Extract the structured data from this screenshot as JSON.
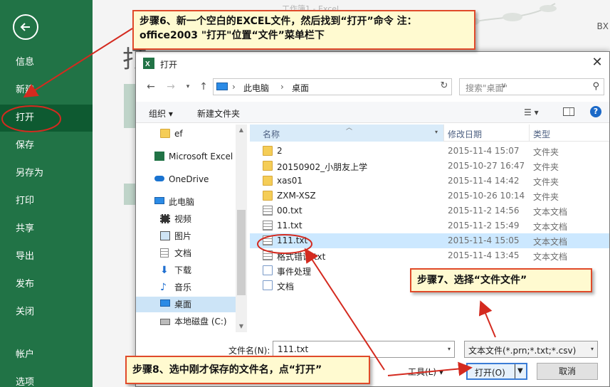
{
  "excel": {
    "doc_title": "工作簿1 - Excel",
    "user": "BX",
    "heading": "打",
    "nav_items": [
      "信息",
      "新建",
      "打开",
      "保存",
      "另存为",
      "打印",
      "共享",
      "导出",
      "发布",
      "关闭",
      "帐户",
      "选项"
    ],
    "active_item": "打开"
  },
  "dialog": {
    "title": "打开",
    "close_glyph": "✕",
    "address": {
      "pc": "此电脑",
      "folder": "桌面"
    },
    "search_placeholder": "搜索\"桌面\"",
    "toolbar": {
      "organize": "组织 ▾",
      "new_folder": "新建文件夹",
      "view_glyph": "☰ ▾",
      "help": "?"
    },
    "nav_tree": [
      {
        "label": "ef",
        "icon": "folder-icon"
      },
      {
        "label": "Microsoft Excel",
        "icon": "excel-icon"
      },
      {
        "label": "OneDrive",
        "icon": "cloud-icon"
      },
      {
        "label": "此电脑",
        "icon": "computer-icon"
      },
      {
        "label": "视频",
        "icon": "video-icon"
      },
      {
        "label": "图片",
        "icon": "picture-icon"
      },
      {
        "label": "文档",
        "icon": "document-icon"
      },
      {
        "label": "下载",
        "icon": "download-icon"
      },
      {
        "label": "音乐",
        "icon": "music-icon"
      },
      {
        "label": "桌面",
        "icon": "desktop-icon"
      },
      {
        "label": "本地磁盘 (C:)",
        "icon": "drive-icon"
      }
    ],
    "columns": {
      "name": "名称",
      "modified": "修改日期",
      "type": "类型"
    },
    "files": [
      {
        "name": "2",
        "date": "2015-11-4 15:07",
        "type": "文件夹",
        "kind": "folder"
      },
      {
        "name": "20150902_小朋友上学",
        "date": "2015-10-27 16:47",
        "type": "文件夹",
        "kind": "folder"
      },
      {
        "name": "xas01",
        "date": "2015-11-4 14:42",
        "type": "文件夹",
        "kind": "folder"
      },
      {
        "name": "ZXM-XSZ",
        "date": "2015-10-26 10:14",
        "type": "文件夹",
        "kind": "folder"
      },
      {
        "name": "00.txt",
        "date": "2015-11-2 14:56",
        "type": "文本文档",
        "kind": "txt"
      },
      {
        "name": "11.txt",
        "date": "2015-11-2 15:49",
        "type": "文本文档",
        "kind": "txt"
      },
      {
        "name": "111.txt",
        "date": "2015-11-4 15:05",
        "type": "文本文档",
        "kind": "txt"
      },
      {
        "name": "格式错误.txt",
        "date": "2015-11-4 13:45",
        "type": "文本文档",
        "kind": "txt"
      },
      {
        "name": "事件处理",
        "date": "",
        "type": "",
        "kind": "shortcut"
      },
      {
        "name": "文档",
        "date": "",
        "type": "",
        "kind": "shortcut"
      }
    ],
    "filename_label": "文件名(N):",
    "filename_value": "111.txt",
    "filter_value": "文本文件(*.prn;*.txt;*.csv)",
    "tools_label": "工具(L)  ▾",
    "open_label": "打开(O)",
    "cancel_label": "取消"
  },
  "annotations": {
    "step6": "步骤6、新一个空白的EXCEL文件，然后找到“打开”命令 注：office2003 \"打开\"位置“文件”菜单栏下",
    "step7": "步骤7、选择“文件文件”",
    "step8": "步骤8、选中刚才保存的文件名，点“打开”"
  },
  "colors": {
    "excel_green": "#217346",
    "callout_border": "#e04a2a",
    "callout_bg": "#fffad0",
    "arrow": "#d42a1f"
  }
}
